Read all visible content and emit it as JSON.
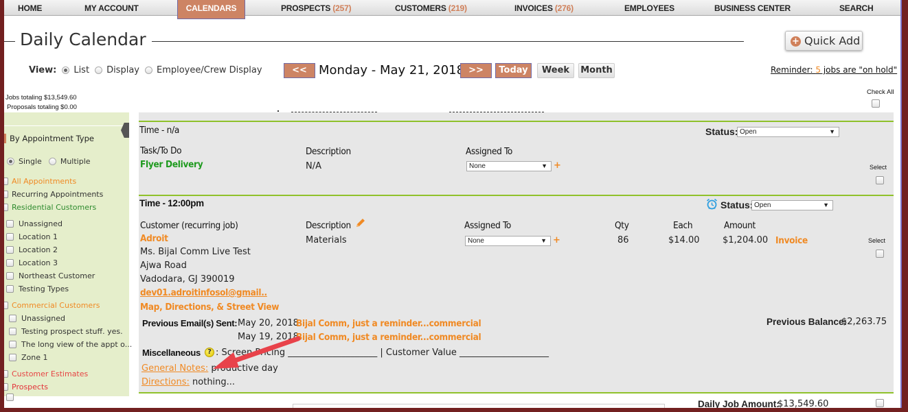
{
  "nav": {
    "items": [
      {
        "label": "HOME"
      },
      {
        "label": "MY ACCOUNT"
      },
      {
        "label": "CALENDARS",
        "active": true
      },
      {
        "label": "PROSPECTS",
        "count": "(257)"
      },
      {
        "label": "CUSTOMERS",
        "count": "(219)"
      },
      {
        "label": "INVOICES",
        "count": "(276)"
      },
      {
        "label": "EMPLOYEES"
      },
      {
        "label": "BUSINESS CENTER"
      },
      {
        "label": "SEARCH"
      }
    ]
  },
  "header": {
    "title": "Daily Calendar",
    "quick_add": "Quick Add",
    "quick_add_icon": "plus-circle-icon",
    "view_label": "View:",
    "view_options": [
      {
        "label": "List",
        "selected": true
      },
      {
        "label": "Display",
        "selected": false
      },
      {
        "label": "Employee/Crew Display",
        "selected": false
      }
    ],
    "prev_label": "<<",
    "next_label": ">>",
    "date": "Monday - May 21, 2018",
    "today_label": "Today",
    "week_label": "Week",
    "month_label": "Month",
    "reminder_prefix": "Reminder: ",
    "reminder_count": "5",
    "reminder_suffix": " jobs are \"on hold\"",
    "jobs_total": "Jobs totaling $13,549.60",
    "proposals_total": "Proposals totaling $0.00",
    "check_all": "Check All"
  },
  "sidebar": {
    "heading": "By Appointment Type",
    "modes": [
      {
        "label": "Single",
        "selected": true
      },
      {
        "label": "Multiple",
        "selected": false
      }
    ],
    "items": [
      {
        "label": "All Appointments",
        "color": "#f08a24",
        "level": 0
      },
      {
        "label": "Recurring Appointments",
        "color": "#333333",
        "level": 0
      },
      {
        "label": "Residential Customers",
        "color": "#2e8b2e",
        "level": 0
      },
      {
        "label": "Unassigned",
        "color": "#333333",
        "level": 1
      },
      {
        "label": "Location 1",
        "color": "#333333",
        "level": 1
      },
      {
        "label": "Location 2",
        "color": "#333333",
        "level": 1
      },
      {
        "label": "Location 3",
        "color": "#333333",
        "level": 1
      },
      {
        "label": "Northeast Customer",
        "color": "#333333",
        "level": 1
      },
      {
        "label": "Testing Types",
        "color": "#333333",
        "level": 1
      },
      {
        "label": "Commercial Customers",
        "color": "#f08a24",
        "level": 0
      },
      {
        "label": "Unassigned",
        "color": "#333333",
        "level": 2
      },
      {
        "label": "Testing prospect stuff. yes.",
        "color": "#333333",
        "level": 2
      },
      {
        "label": "The long view of the appt o...",
        "color": "#333333",
        "level": 2
      },
      {
        "label": "Zone 1",
        "color": "#333333",
        "level": 2
      },
      {
        "label": "Customer Estimates",
        "color": "#e64444",
        "level": 0
      },
      {
        "label": "Prospects",
        "color": "#e3333a",
        "level": 0
      }
    ]
  },
  "appointments": [
    {
      "time": "Time - n/a",
      "status_label": "Status:",
      "status": "Open",
      "col1_header": "Task/To Do",
      "col1_value": "Flyer Delivery",
      "desc_header": "Description",
      "desc_value": "N/A",
      "assigned_header": "Assigned To",
      "assigned_value": "None",
      "select_label": "Select"
    },
    {
      "time": "Time - 12:00pm",
      "status_label": "Status:",
      "status": "Open",
      "alarm_icon": "alarm-clock-icon",
      "col1_header": "Customer (recurring job)",
      "customer_name": "Adroit",
      "contact": "Ms. Bijal Comm Live Test",
      "address1": "Ajwa Road",
      "address2": "Vadodara, GJ 390019",
      "email": "dev01.adroitinfosol@gmail..",
      "map_link": "Map, Directions, & Street View",
      "desc_header": "Description",
      "desc_value": "Materials",
      "assigned_header": "Assigned To",
      "assigned_value": "None",
      "qty_header": "Qty",
      "each_header": "Each",
      "amount_header": "Amount",
      "qty": "86",
      "each": "$14.00",
      "amount": "$1,204.00",
      "invoice_link": "Invoice",
      "select_label": "Select",
      "prev_emails_label": "Previous Email(s) Sent:",
      "emails": [
        {
          "date": "May 20, 2018",
          "subject": "Bijal Comm, just a reminder...commercial"
        },
        {
          "date": "May 19, 2018",
          "subject": "Bijal Comm, just a reminder...commercial"
        }
      ],
      "prev_balance_label": "Previous Balance:",
      "prev_balance": "$2,263.75",
      "misc_label": "Miscellaneous",
      "misc_text": ": Screen Pricing ____________________ | Customer Value ____________________",
      "general_notes_label": "General Notes:",
      "general_notes": " productive day",
      "directions_label": "Directions:",
      "directions": " nothing..."
    }
  ],
  "footer": {
    "daily_job_label": "Daily Job Amount:",
    "daily_job_amount": "$13,549.60"
  },
  "colors": {
    "accent": "#cd8464",
    "link": "#f08a24",
    "frame": "#722020",
    "separator": "#8fc12a",
    "sidebar_bg": "#e5eecb",
    "panel_bg": "#e7e7e7"
  }
}
